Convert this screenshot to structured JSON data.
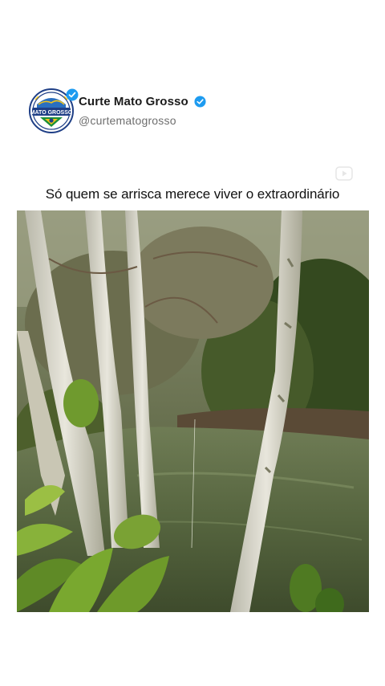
{
  "profile": {
    "display_name": "Curte Mato Grosso",
    "handle": "@curtematogrosso",
    "verified": true,
    "avatar_icon": "mato-grosso-logo",
    "avatar_text": "MATO GROSSO"
  },
  "post": {
    "caption": "Só quem se arrisca merece viver o extraordinário"
  },
  "media": {
    "type": "video-frame",
    "subject": "trees beside a green forest pond"
  },
  "colors": {
    "verified_blue": "#1d9bf0",
    "avatar_blue": "#1f3f86",
    "avatar_yellow": "#f2c31a",
    "avatar_green": "#1a8f3a"
  }
}
